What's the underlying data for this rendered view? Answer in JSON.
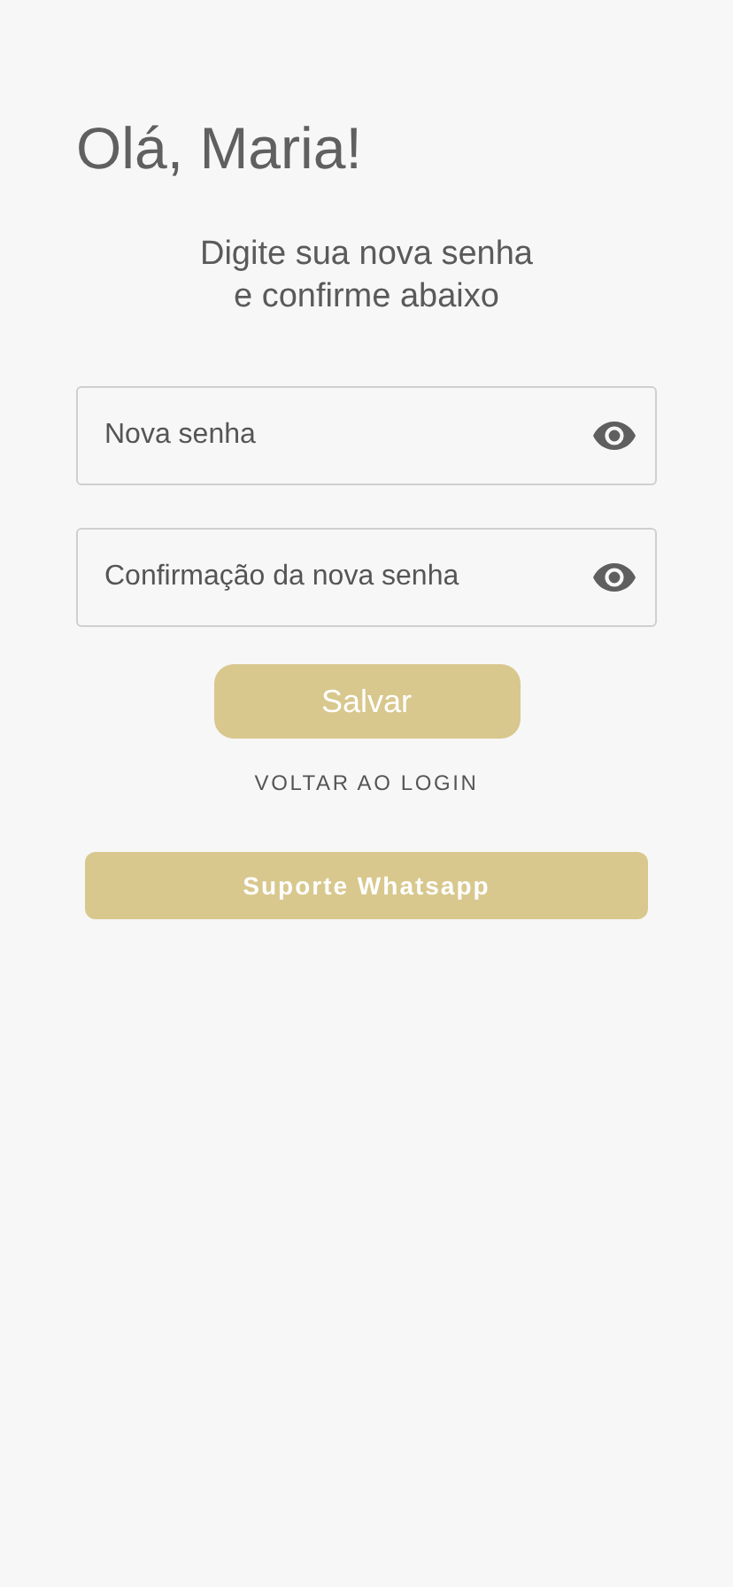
{
  "greeting": "Olá, Maria!",
  "instructions": [
    "Digite sua nova senha",
    "e confirme abaixo"
  ],
  "fields": [
    {
      "placeholder": "Nova senha"
    },
    {
      "placeholder": "Confirmação da nova senha"
    }
  ],
  "save_button": "Salvar",
  "back_link": "VOLTAR AO LOGIN",
  "support_button": "Suporte Whatsapp"
}
